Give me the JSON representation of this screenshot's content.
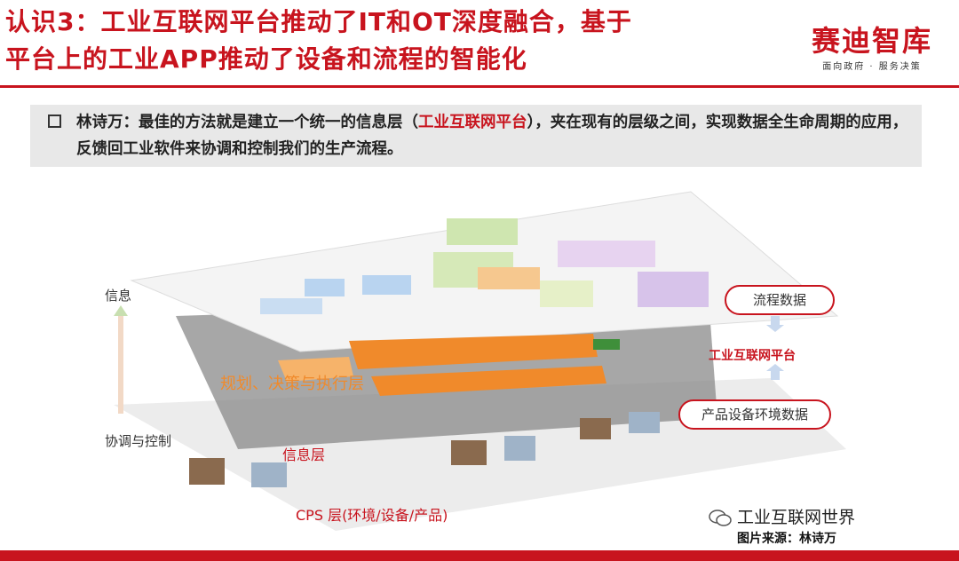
{
  "title": {
    "line1": "认识3：工业互联网平台推动了IT和OT深度融合，基于",
    "line2": "平台上的工业APP推动了设备和流程的智能化"
  },
  "logo": {
    "name": "赛迪智库",
    "tagline": "面向政府 · 服务决策"
  },
  "quote": {
    "part1": "林诗万：最佳的方法就是建立一个统一的信息层（",
    "highlight": "工业互联网平台",
    "part2": "），夹在现有的层级之间，实现数据全生命周期的应用，反馈回工业软件来协调和控制我们的生产流程。"
  },
  "diagram": {
    "left_top": "信息",
    "left_bottom": "协调与控制",
    "top_right": "流程数据",
    "middle_right": "工业互联网平台",
    "bottom_right": "产品设备环境数据",
    "middle_layer": "规划、决策与执行层",
    "info_layer": "信息层",
    "cps_layer": "CPS 层(环境/设备/产品)"
  },
  "footer": {
    "wechat": "工业互联网世界",
    "source": "图片来源：林诗万"
  },
  "colors": {
    "accent": "#c8141e"
  }
}
